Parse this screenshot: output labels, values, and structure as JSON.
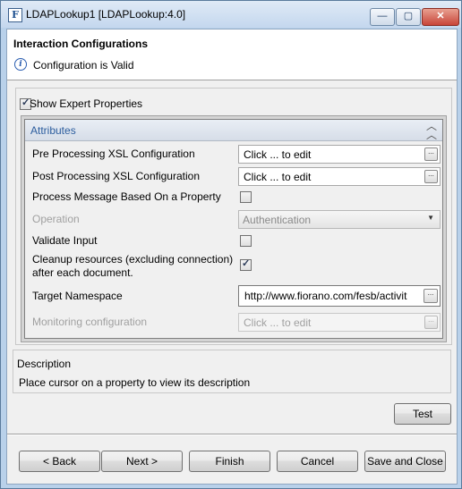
{
  "window": {
    "title": "LDAPLookup1 [LDAPLookup:4.0]",
    "icon_glyph": "F",
    "controls": {
      "minimize": "—",
      "maximize": "▢",
      "close": "✕"
    }
  },
  "header": {
    "title": "Interaction Configurations",
    "status": "Configuration is Valid",
    "status_icon": "info-icon"
  },
  "expert": {
    "label": "Show Expert Properties",
    "checked": true
  },
  "attributes": {
    "title": "Attributes",
    "collapse_icon": "chevrons-up-icon",
    "rows": [
      {
        "label": "Pre Processing XSL Configuration",
        "value": "Click ... to edit",
        "button": "...",
        "enabled": true
      },
      {
        "label": "Post Processing XSL Configuration",
        "value": "Click ... to edit",
        "button": "...",
        "enabled": true
      },
      {
        "label": "Process Message Based On a Property",
        "checked": false,
        "enabled": true
      },
      {
        "label": "Operation",
        "value": "Authentication",
        "enabled": false
      },
      {
        "label": "Validate Input",
        "checked": false,
        "enabled": true
      },
      {
        "label_line1": "Cleanup resources (excluding connection)",
        "label_line2": "after each document.",
        "checked": true,
        "enabled": true
      },
      {
        "label": "Target Namespace",
        "value": "http://www.fiorano.com/fesb/activit",
        "button": "...",
        "enabled": true
      },
      {
        "label": "Monitoring configuration",
        "value": "Click ... to edit",
        "button": "...",
        "enabled": false
      }
    ]
  },
  "description": {
    "title": "Description",
    "text": "Place cursor on a property to view its description"
  },
  "buttons": {
    "test": "Test",
    "back": "< Back",
    "next": "Next >",
    "finish": "Finish",
    "cancel": "Cancel",
    "save_close": "Save and Close"
  }
}
